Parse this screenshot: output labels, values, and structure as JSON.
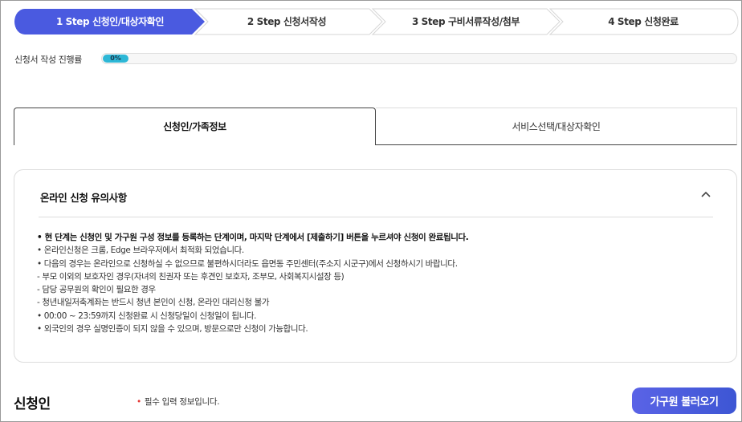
{
  "steps": [
    {
      "label": "1 Step 신청인/대상자확인",
      "active": true
    },
    {
      "label": "2 Step 신청서작성",
      "active": false
    },
    {
      "label": "3 Step 구비서류작성/첨부",
      "active": false
    },
    {
      "label": "4 Step 신청완료",
      "active": false
    }
  ],
  "progress": {
    "label": "신청서 작성 진행률",
    "value_text": "0%",
    "value": 0
  },
  "tabs": [
    {
      "label": "신청인/가족정보",
      "active": true
    },
    {
      "label": "서비스선택/대상자확인",
      "active": false
    }
  ],
  "notice": {
    "title": "온라인 신청 유의사항",
    "items": [
      "• 현 단계는 신청인 및 가구원 구성 정보를 등록하는 단계이며, 마지막 단계에서 [제출하기] 버튼을 누르셔야 신청이 완료됩니다.",
      "• 온라인신청은 크롬, Edge 브라우저에서 최적화 되었습니다.",
      "• 다음의 경우는 온라인으로 신청하실 수 없으므로 불편하시더라도 읍면동 주민센터(주소지 시군구)에서 신청하시기 바랍니다.",
      "   - 부모 이외의 보호자인 경우(자녀의 친권자 또는 후견인 보호자, 조부모, 사회복지시설장 등)",
      "   - 담당 공무원의 확인이 필요한 경우",
      "   - 청년내일저축계좌는 반드시 청년 본인이 신청, 온라인 대리신청 불가",
      "• 00:00 ~ 23:59까지 신청완료 시 신청당일이 신청일이 됩니다.",
      "• 외국인의 경우 실명인증이 되지 않을 수 있으며, 방문으로만 신청이 가능합니다."
    ]
  },
  "section": {
    "title": "신청인",
    "required_mark": "•",
    "required_text": "필수 입력 정보입니다.",
    "load_button": "가구원 불러오기"
  },
  "colors": {
    "step_active": "#4a5ae0",
    "progress_fill": "#2db7d6",
    "button": "#4a5ae0",
    "required": "#e53935"
  }
}
